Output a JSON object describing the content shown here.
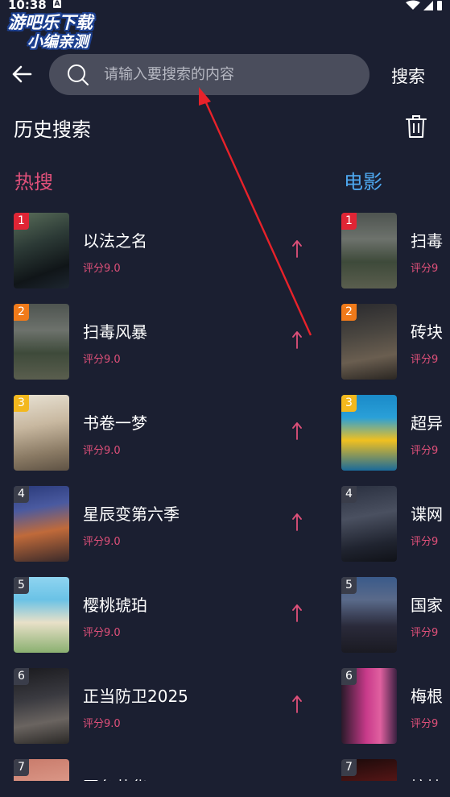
{
  "status_bar": {
    "time": "10:38",
    "notification_badge": "A"
  },
  "watermark": {
    "line1": "游吧乐下载",
    "line2": "小编亲测"
  },
  "search": {
    "placeholder": "请输入要搜索的内容",
    "button_label": "搜索"
  },
  "history": {
    "title": "历史搜索"
  },
  "hot": {
    "title": "热搜",
    "items": [
      {
        "rank": "1",
        "name": "以法之名",
        "score": "评分9.0"
      },
      {
        "rank": "2",
        "name": "扫毒风暴",
        "score": "评分9.0"
      },
      {
        "rank": "3",
        "name": "书卷一梦",
        "score": "评分9.0"
      },
      {
        "rank": "4",
        "name": "星辰变第六季",
        "score": "评分9.0"
      },
      {
        "rank": "5",
        "name": "樱桃琥珀",
        "score": "评分9.0"
      },
      {
        "rank": "6",
        "name": "正当防卫2025",
        "score": "评分9.0"
      },
      {
        "rank": "7",
        "name": "国色芳华",
        "score": ""
      }
    ]
  },
  "movie": {
    "title": "电影",
    "items": [
      {
        "rank": "1",
        "name": "扫毒",
        "score": "评分9"
      },
      {
        "rank": "2",
        "name": "砖块",
        "score": "评分9"
      },
      {
        "rank": "3",
        "name": "超异",
        "score": "评分9"
      },
      {
        "rank": "4",
        "name": "谍网",
        "score": "评分9"
      },
      {
        "rank": "5",
        "name": "国家",
        "score": "评分9"
      },
      {
        "rank": "6",
        "name": "梅根",
        "score": "评分9"
      },
      {
        "rank": "7",
        "name": "惊悚",
        "score": ""
      }
    ]
  },
  "colors": {
    "background": "#1b1f31",
    "search_box": "#4a4d5c",
    "hot_accent": "#e0507a",
    "movie_accent": "#4ea8f0",
    "rank1": "#e02535",
    "rank2": "#f07a1a",
    "rank3": "#f3b81d",
    "rank_other": "#3a3d4a",
    "annotation": "#e8222a"
  }
}
